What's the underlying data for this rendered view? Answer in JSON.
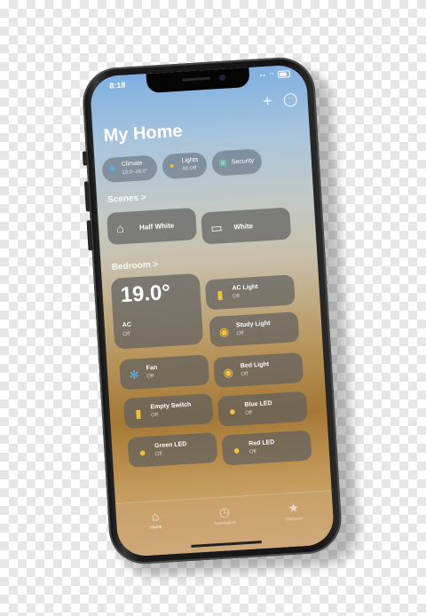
{
  "status": {
    "time": "8:18"
  },
  "header": {
    "title": "My Home",
    "add_icon": "+",
    "more_icon": "···"
  },
  "chips": [
    {
      "icon": "climate-icon",
      "label": "Climate",
      "sub": "19.0–28.0°"
    },
    {
      "icon": "lightbulb-icon",
      "label": "Lights",
      "sub": "All Off"
    },
    {
      "icon": "lock-icon",
      "label": "Security",
      "sub": ""
    }
  ],
  "scenes": {
    "section": "Scenes >",
    "items": [
      {
        "icon": "house-icon",
        "label": "Half White"
      },
      {
        "icon": "bed-icon",
        "label": "White"
      }
    ]
  },
  "bedroom": {
    "section": "Bedroom >",
    "ac": {
      "temp": "19.0°",
      "name": "AC",
      "state": "Off"
    },
    "accessories": [
      {
        "icon": "switch-icon",
        "name": "AC Light",
        "state": "Off"
      },
      {
        "icon": "ceiling-light-icon",
        "name": "Study Light",
        "state": "Off"
      },
      {
        "icon": "fan-icon",
        "name": "Fan",
        "state": "Off"
      },
      {
        "icon": "ceiling-light-icon",
        "name": "Bed Light",
        "state": "Off"
      },
      {
        "icon": "switch-icon",
        "name": "Empty Switch",
        "state": "Off"
      },
      {
        "icon": "lightbulb-icon",
        "name": "Blue LED",
        "state": "Off"
      },
      {
        "icon": "lightbulb-icon",
        "name": "Green LED",
        "state": "Off"
      },
      {
        "icon": "lightbulb-icon",
        "name": "Red LED",
        "state": "Off"
      }
    ]
  },
  "tabs": [
    {
      "icon": "house-icon",
      "label": "Home"
    },
    {
      "icon": "clock-icon",
      "label": "Automation"
    },
    {
      "icon": "star-icon",
      "label": "Discover"
    }
  ],
  "colors": {
    "accent_yellow": "#f3c23a",
    "fan_blue": "#58b6e8"
  }
}
